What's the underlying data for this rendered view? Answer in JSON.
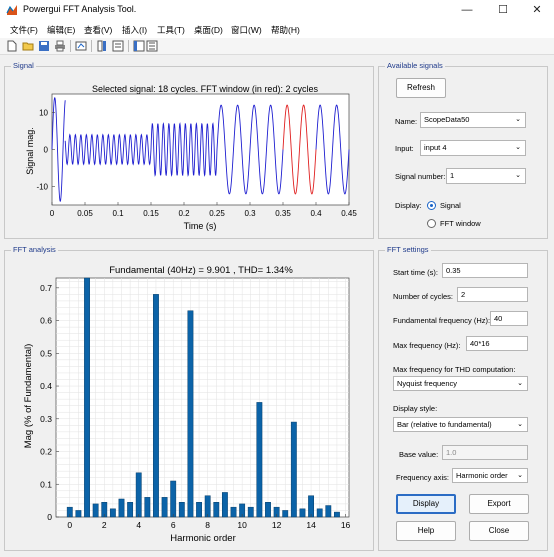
{
  "window": {
    "title": "Powergui FFT Analysis Tool."
  },
  "menu": [
    "文件(F)",
    "编辑(E)",
    "查看(V)",
    "插入(I)",
    "工具(T)",
    "桌面(D)",
    "窗口(W)",
    "帮助(H)"
  ],
  "signal_panel": {
    "title": "Signal",
    "plot_title": "Selected signal: 18 cycles. FFT window (in red): 2 cycles",
    "xlabel": "Time (s)",
    "ylabel": "Signal mag.",
    "xticks": [
      "0",
      "0.05",
      "0.1",
      "0.15",
      "0.2",
      "0.25",
      "0.3",
      "0.35",
      "0.4",
      "0.45"
    ],
    "yticks": [
      "10",
      "0",
      "-10"
    ]
  },
  "available_signals": {
    "title": "Available signals",
    "refresh_label": "Refresh",
    "name_label": "Name:",
    "name_value": "ScopeData50",
    "input_label": "Input:",
    "input_value": "input 4",
    "signal_number_label": "Signal number:",
    "signal_number_value": "1",
    "display_label": "Display:",
    "display_options": [
      "Signal",
      "FFT window"
    ]
  },
  "fft_panel": {
    "title": "FFT analysis",
    "plot_title": "Fundamental (40Hz) = 9.901 , THD= 1.34%",
    "xlabel": "Harmonic order",
    "ylabel": "Mag (% of Fundamental)",
    "xticks": [
      "0",
      "2",
      "4",
      "6",
      "8",
      "10",
      "12",
      "14",
      "16"
    ],
    "yticks": [
      "0",
      "0.1",
      "0.2",
      "0.3",
      "0.4",
      "0.5",
      "0.6",
      "0.7"
    ]
  },
  "fft_settings": {
    "title": "FFT settings",
    "start_time_label": "Start time (s):",
    "start_time_value": "0.35",
    "cycles_label": "Number of cycles:",
    "cycles_value": "2",
    "fund_freq_label": "Fundamental frequency (Hz):",
    "fund_freq_value": "40",
    "max_freq_label": "Max frequency (Hz):",
    "max_freq_value": "40*16",
    "thd_label": "Max frequency for THD computation:",
    "thd_value": "Nyquist frequency",
    "display_style_label": "Display style:",
    "display_style_value": "Bar (relative to fundamental)",
    "base_value_label": "Base value:",
    "base_value_value": "1.0",
    "freq_axis_label": "Frequency axis:",
    "freq_axis_value": "Harmonic order",
    "display_btn": "Display",
    "export_btn": "Export",
    "help_btn": "Help",
    "close_btn": "Close"
  },
  "chart_data": [
    {
      "type": "line",
      "title": "Selected signal: 18 cycles. FFT window (in red): 2 cycles",
      "xlabel": "Time (s)",
      "ylabel": "Signal mag.",
      "xlim": [
        0,
        0.45
      ],
      "ylim": [
        -15,
        15
      ],
      "grid": false,
      "series": [
        {
          "color": "#1f1fd0",
          "segments": [
            {
              "t0": 0.0,
              "t1": 0.02,
              "amp": 14,
              "freq": 60
            },
            {
              "t0": 0.02,
              "t1": 0.15,
              "amp": 4,
              "freq": 120
            },
            {
              "t0": 0.15,
              "t1": 0.25,
              "amp": 7,
              "freq": 120
            },
            {
              "t0": 0.25,
              "t1": 0.35,
              "amp": 12,
              "freq": 40
            },
            {
              "t0": 0.4,
              "t1": 0.45,
              "amp": 12,
              "freq": 40
            }
          ]
        },
        {
          "color": "#e02020",
          "segments": [
            {
              "t0": 0.35,
              "t1": 0.4,
              "amp": 12,
              "freq": 40
            }
          ]
        }
      ]
    },
    {
      "type": "bar",
      "title": "Fundamental (40Hz) = 9.901 , THD= 1.34%",
      "xlabel": "Harmonic order",
      "ylabel": "Mag (% of Fundamental)",
      "xlim": [
        -0.8,
        16.2
      ],
      "ylim": [
        0,
        0.73
      ],
      "grid": true,
      "bar_color": "#0b63a8",
      "categories": [
        0,
        0.5,
        1,
        1.5,
        2,
        2.5,
        3,
        3.5,
        4,
        4.5,
        5,
        5.5,
        6,
        6.5,
        7,
        7.5,
        8,
        8.5,
        9,
        9.5,
        10,
        10.5,
        11,
        11.5,
        12,
        12.5,
        13,
        13.5,
        14,
        14.5,
        15,
        15.5
      ],
      "values": [
        0.03,
        0.02,
        0.73,
        0.04,
        0.045,
        0.025,
        0.055,
        0.045,
        0.135,
        0.06,
        0.68,
        0.06,
        0.11,
        0.045,
        0.63,
        0.045,
        0.065,
        0.045,
        0.075,
        0.03,
        0.04,
        0.03,
        0.35,
        0.045,
        0.03,
        0.02,
        0.29,
        0.025,
        0.065,
        0.025,
        0.035,
        0.015
      ]
    }
  ]
}
